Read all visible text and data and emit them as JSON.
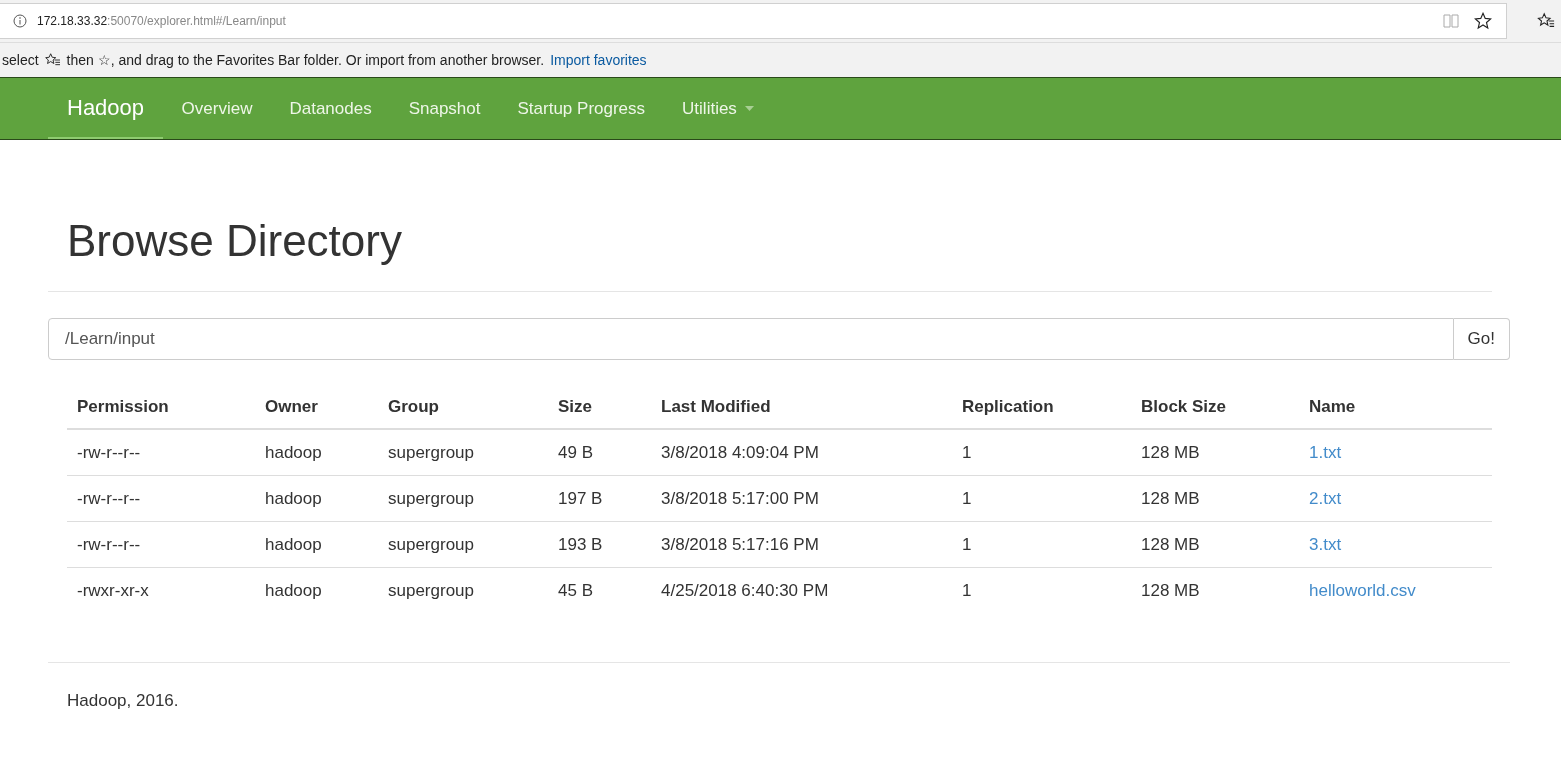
{
  "browser": {
    "url_host": "172.18.33.32",
    "url_path": ":50070/explorer.html#/Learn/input"
  },
  "favorites_bar": {
    "text_before": "select",
    "text_after": "then ☆, and drag to the Favorites Bar folder. Or import from another browser.",
    "link": "Import favorites"
  },
  "navbar": {
    "brand": "Hadoop",
    "items": [
      {
        "label": "Overview",
        "dropdown": false
      },
      {
        "label": "Datanodes",
        "dropdown": false
      },
      {
        "label": "Snapshot",
        "dropdown": false
      },
      {
        "label": "Startup Progress",
        "dropdown": false
      },
      {
        "label": "Utilities",
        "dropdown": true
      }
    ]
  },
  "page": {
    "title": "Browse Directory",
    "path_field": {
      "value": "/Learn/input"
    },
    "go_button": "Go!"
  },
  "table": {
    "columns": [
      "Permission",
      "Owner",
      "Group",
      "Size",
      "Last Modified",
      "Replication",
      "Block Size",
      "Name"
    ],
    "rows": [
      [
        "-rw-r--r--",
        "hadoop",
        "supergroup",
        "49 B",
        "3/8/2018 4:09:04 PM",
        "1",
        "128 MB",
        "1.txt"
      ],
      [
        "-rw-r--r--",
        "hadoop",
        "supergroup",
        "197 B",
        "3/8/2018 5:17:00 PM",
        "1",
        "128 MB",
        "2.txt"
      ],
      [
        "-rw-r--r--",
        "hadoop",
        "supergroup",
        "193 B",
        "3/8/2018 5:17:16 PM",
        "1",
        "128 MB",
        "3.txt"
      ],
      [
        "-rwxr-xr-x",
        "hadoop",
        "supergroup",
        "45 B",
        "4/25/2018 6:40:30 PM",
        "1",
        "128 MB",
        "helloworld.csv"
      ]
    ]
  },
  "footer": "Hadoop, 2016."
}
